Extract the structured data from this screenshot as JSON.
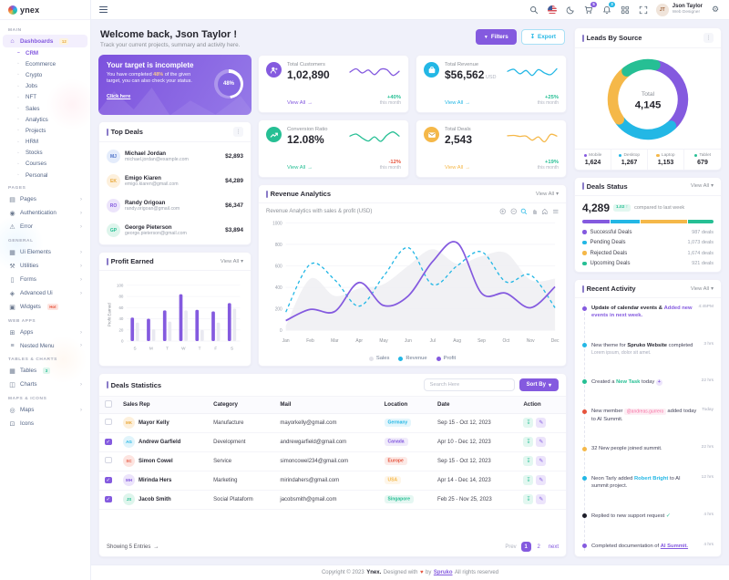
{
  "icons": {
    "chevron_down": "▾",
    "arrow_right": "→",
    "kebab": "⋮",
    "check": "✓",
    "heart": "♥",
    "pencil": "✎",
    "download": "↧",
    "plus": "+",
    "funnel": "▼"
  },
  "sidebar": {
    "logo": "ynex",
    "sections": [
      {
        "label": "MAIN",
        "items": [
          {
            "glyph": "⌂",
            "icon": "home-icon",
            "label": "Dashboards",
            "badge": "12",
            "badge_color": "warning",
            "active": true,
            "children": [
              {
                "label": "CRM",
                "active": true
              },
              {
                "label": "Ecommerce"
              },
              {
                "label": "Crypto"
              },
              {
                "label": "Jobs"
              },
              {
                "label": "NFT"
              },
              {
                "label": "Sales"
              },
              {
                "label": "Analytics"
              },
              {
                "label": "Projects"
              },
              {
                "label": "HRM"
              },
              {
                "label": "Stocks"
              },
              {
                "label": "Courses"
              },
              {
                "label": "Personal"
              }
            ]
          }
        ]
      },
      {
        "label": "PAGES",
        "items": [
          {
            "glyph": "▤",
            "icon": "pages-icon",
            "label": "Pages",
            "arrow": true
          },
          {
            "glyph": "◉",
            "icon": "authentication-icon",
            "label": "Authentication",
            "arrow": true
          },
          {
            "glyph": "⚠",
            "icon": "error-icon",
            "label": "Error",
            "arrow": true
          }
        ]
      },
      {
        "label": "GENERAL",
        "items": [
          {
            "glyph": "▦",
            "icon": "ui-elements-icon",
            "label": "Ui Elements",
            "arrow": true
          },
          {
            "glyph": "⚒",
            "icon": "utilities-icon",
            "label": "Utilities",
            "arrow": true
          },
          {
            "glyph": "▯",
            "icon": "forms-icon",
            "label": "Forms",
            "arrow": true
          },
          {
            "glyph": "◈",
            "icon": "advanced-ui-icon",
            "label": "Advanced Ui",
            "arrow": true
          },
          {
            "glyph": "▣",
            "icon": "widgets-icon",
            "label": "Widgets",
            "badge": "Hot",
            "badge_color": "danger"
          }
        ]
      },
      {
        "label": "WEB APPS",
        "items": [
          {
            "glyph": "⊞",
            "icon": "apps-icon",
            "label": "Apps",
            "arrow": true
          },
          {
            "glyph": "≡",
            "icon": "nested-menu-icon",
            "label": "Nested Menu",
            "arrow": true
          }
        ]
      },
      {
        "label": "TABLES & CHARTS",
        "items": [
          {
            "glyph": "▦",
            "icon": "tables-icon",
            "label": "Tables",
            "badge": "3",
            "badge_color": "success"
          },
          {
            "glyph": "◫",
            "icon": "charts-icon",
            "label": "Charts",
            "arrow": true
          }
        ]
      },
      {
        "label": "MAPS & ICONS",
        "items": [
          {
            "glyph": "◎",
            "icon": "maps-icon",
            "label": "Maps",
            "arrow": true
          },
          {
            "glyph": "⊡",
            "icon": "icons-icon",
            "label": "Icons"
          }
        ]
      }
    ]
  },
  "header": {
    "cart_badge": "5",
    "bell_badge": "3",
    "user": {
      "name": "Json Taylor",
      "role": "Web Designer",
      "initials": "JT"
    }
  },
  "welcome": {
    "title": "Welcome back, Json Taylor !",
    "subtitle": "Track your current projects, summary and activity here.",
    "filters_label": "Filters",
    "export_label": "Export"
  },
  "target_card": {
    "title": "Your target is incomplete",
    "text_before": "You have completed ",
    "highlight": "48%",
    "text_after": " of the given target, you can also check your status.",
    "link": "Click here",
    "progress": "48%"
  },
  "stats": [
    {
      "label": "Total Customers",
      "value": "1,02,890",
      "unit": "",
      "view_all": "View All",
      "change": "+40%",
      "dir": "up",
      "period": "this month",
      "color": "#845adf",
      "icon": "people",
      "spark": [
        55,
        75,
        50,
        68,
        40,
        72,
        70,
        35,
        60
      ]
    },
    {
      "label": "Total Revenue",
      "value": "$56,562",
      "unit": "USD",
      "view_all": "View All",
      "change": "+25%",
      "dir": "up",
      "period": "this month",
      "color": "#23b7e5",
      "icon": "bag",
      "spark": [
        60,
        72,
        45,
        65,
        35,
        70,
        50,
        40,
        75
      ]
    },
    {
      "label": "Conversion Ratio",
      "value": "12.08%",
      "unit": "",
      "view_all": "View All",
      "change": "-12%",
      "dir": "down",
      "period": "this month",
      "color": "#26bf94",
      "icon": "trend",
      "spark": [
        60,
        72,
        48,
        30,
        55,
        28,
        65,
        85,
        60
      ]
    },
    {
      "label": "Total Deals",
      "value": "2,543",
      "unit": "",
      "view_all": "View All",
      "change": "+19%",
      "dir": "up",
      "period": "this month",
      "color": "#f5b849",
      "icon": "mail",
      "spark": [
        62,
        64,
        58,
        60,
        35,
        55,
        25,
        70,
        60
      ]
    }
  ],
  "top_deals": {
    "title": "Top Deals",
    "entries": [
      {
        "name": "Michael Jordan",
        "email": "michael.jordan@example.com",
        "amount": "$2,893",
        "initials": "MJ",
        "av_bg": "#e4ecfb",
        "av_fg": "#4b70c9"
      },
      {
        "name": "Emigo Kiaren",
        "email": "emigo.kiaren@gmail.com",
        "amount": "$4,289",
        "initials": "EK",
        "av_bg": "#fdf0dc",
        "av_fg": "#e9a93c"
      },
      {
        "name": "Randy Origoan",
        "email": "randy.origoan@gmail.com",
        "amount": "$6,347",
        "initials": "RO",
        "av_bg": "#ece4fb",
        "av_fg": "#845adf"
      },
      {
        "name": "George Pieterson",
        "email": "george.pieterson@gmail.com",
        "amount": "$3,894",
        "initials": "GP",
        "av_bg": "#def5ec",
        "av_fg": "#26bf94"
      }
    ]
  },
  "profit_earned": {
    "title": "Profit Earned",
    "view_all": "View All",
    "chart": {
      "type": "bar",
      "categories": [
        "S",
        "M",
        "T",
        "W",
        "T",
        "F",
        "S"
      ],
      "series": [
        {
          "name": "Profit",
          "color": "#845adf",
          "values": [
            42,
            40,
            55,
            84,
            56,
            53,
            68
          ]
        },
        {
          "name": "Previous",
          "color": "#e9e9f1",
          "values": [
            33,
            21,
            35,
            55,
            20,
            33,
            58
          ]
        }
      ],
      "ylabel": "Profit Earned",
      "ylim": [
        0,
        100
      ],
      "ystep": 20
    }
  },
  "revenue_analytics": {
    "title": "Revenue Analytics",
    "view_all": "View All",
    "subtitle": "Revenue Analytics with sales & profit (USD)",
    "chart": {
      "type": "line",
      "x": [
        "Jan",
        "Feb",
        "Mar",
        "Apr",
        "May",
        "Jun",
        "Jul",
        "Aug",
        "Sep",
        "Oct",
        "Nov",
        "Dec"
      ],
      "series": [
        {
          "name": "Sales",
          "style": "area",
          "color": "#efeff3",
          "dot": "#e3e3ea",
          "values": [
            40,
            480,
            320,
            390,
            430,
            600,
            755,
            620,
            690,
            720,
            470,
            480
          ]
        },
        {
          "name": "Revenue",
          "style": "dashed",
          "color": "#23b7e5",
          "dot": "#23b7e5",
          "values": [
            170,
            615,
            470,
            225,
            505,
            770,
            425,
            600,
            730,
            450,
            515,
            210
          ]
        },
        {
          "name": "Profit",
          "style": "solid",
          "color": "#845adf",
          "dot": "#845adf",
          "values": [
            90,
            195,
            175,
            445,
            230,
            320,
            640,
            815,
            345,
            345,
            210,
            405
          ]
        }
      ],
      "ylim": [
        0,
        1000
      ],
      "ystep": 200
    }
  },
  "leads_by_source": {
    "title": "Leads By Source",
    "center_label": "Total",
    "center_value": "4,145",
    "segments": [
      {
        "label": "Mobile",
        "value": "1,624",
        "num": 1624,
        "color": "#845adf"
      },
      {
        "label": "Desktop",
        "value": "1,267",
        "num": 1267,
        "color": "#23b7e5"
      },
      {
        "label": "Laptop",
        "value": "1,153",
        "num": 1153,
        "color": "#f5b849"
      },
      {
        "label": "Tablet",
        "value": "679",
        "num": 679,
        "color": "#26bf94"
      }
    ]
  },
  "deals_status": {
    "title": "Deals Status",
    "view_all": "View All",
    "value": "4,289",
    "badge": "1.02 ↑",
    "compare": "compared to last week",
    "items": [
      {
        "label": "Successful Deals",
        "value": "987 deals",
        "num": 987,
        "color": "#845adf"
      },
      {
        "label": "Pending Deals",
        "value": "1,073 deals",
        "num": 1073,
        "color": "#23b7e5"
      },
      {
        "label": "Rejected Deals",
        "value": "1,674 deals",
        "num": 1674,
        "color": "#f5b849"
      },
      {
        "label": "Upcoming Deals",
        "value": "921 deals",
        "num": 921,
        "color": "#26bf94"
      }
    ]
  },
  "recent_activity": {
    "title": "Recent Activity",
    "view_all": "View All",
    "items": [
      {
        "dot": "#845adf",
        "time": "4:45PM",
        "parts": [
          {
            "s": "fw",
            "t": "Update of calendar events &"
          },
          {
            "s": "lp",
            "t": "Added new events in next week."
          }
        ]
      },
      {
        "dot": "#23b7e5",
        "time": "3 hrs",
        "parts": [
          {
            "s": "p",
            "t": "New theme for"
          },
          {
            "s": "fw",
            "t": "Spruko Website"
          },
          {
            "s": "p",
            "t": "completed"
          }
        ],
        "sub": "Lorem ipsum, dolor sit amet."
      },
      {
        "dot": "#26bf94",
        "time": "22 hrs",
        "parts": [
          {
            "s": "p",
            "t": "Created a"
          },
          {
            "s": "ls",
            "t": "New Task"
          },
          {
            "s": "p",
            "t": "today"
          }
        ],
        "suffix": "plus"
      },
      {
        "dot": "#e6533c",
        "time": "Today",
        "parts": [
          {
            "s": "p",
            "t": "New member"
          },
          {
            "s": "bp",
            "t": "@andreas.gurrero"
          },
          {
            "s": "p",
            "t": "added today to AI Summit."
          }
        ]
      },
      {
        "dot": "#f5b849",
        "time": "22 hrs",
        "parts": [
          {
            "s": "p",
            "t": "32 New people joined summit."
          }
        ]
      },
      {
        "dot": "#23b7e5",
        "time": "12 hrs",
        "parts": [
          {
            "s": "p",
            "t": "Neon Tarly added"
          },
          {
            "s": "li2",
            "t": "Robert Bright"
          },
          {
            "s": "p",
            "t": "to AI summit project."
          }
        ]
      },
      {
        "dot": "#1c1c28",
        "time": "4 hrs",
        "parts": [
          {
            "s": "p",
            "t": "Replied to new support request"
          }
        ],
        "suffix": "check"
      },
      {
        "dot": "#845adf",
        "time": "4 hrs",
        "parts": [
          {
            "s": "p",
            "t": "Completed documentation of"
          },
          {
            "s": "lu",
            "t": "AI Summit."
          }
        ]
      }
    ]
  },
  "deals_table": {
    "title": "Deals Statistics",
    "search_placeholder": "Search Here",
    "sort_label": "Sort By",
    "columns": [
      "Sales Rep",
      "Category",
      "Mail",
      "Location",
      "Date",
      "Action"
    ],
    "rows": [
      {
        "checked": false,
        "name": "Mayor Kelly",
        "initials": "MK",
        "av_bg": "#fdf0dc",
        "av_fg": "#e9a93c",
        "category": "Manufacture",
        "mail": "mayorkelly@gmail.com",
        "location": "Germany",
        "loc_color": "#23b7e5",
        "date": "Sep 15 - Oct 12, 2023"
      },
      {
        "checked": true,
        "name": "Andrew Garfield",
        "initials": "AG",
        "av_bg": "#e0f4fb",
        "av_fg": "#23b7e5",
        "category": "Development",
        "mail": "andrewgarfield@gmail.com",
        "location": "Canada",
        "loc_color": "#845adf",
        "date": "Apr 10 - Dec 12, 2023"
      },
      {
        "checked": false,
        "name": "Simon Cowel",
        "initials": "SC",
        "av_bg": "#fde4e0",
        "av_fg": "#e6533c",
        "category": "Service",
        "mail": "simoncowel234@gmail.com",
        "location": "Europe",
        "loc_color": "#e6533c",
        "date": "Sep 15 - Oct 12, 2023"
      },
      {
        "checked": true,
        "name": "Mirinda Hers",
        "initials": "MH",
        "av_bg": "#ece4fb",
        "av_fg": "#845adf",
        "category": "Marketing",
        "mail": "mirindahers@gmail.com",
        "location": "USA",
        "loc_color": "#f5b849",
        "date": "Apr 14 - Dec 14, 2023"
      },
      {
        "checked": true,
        "name": "Jacob Smith",
        "initials": "JS",
        "av_bg": "#def5ec",
        "av_fg": "#26bf94",
        "category": "Social Plataform",
        "mail": "jacobsmith@gmail.com",
        "location": "Singapore",
        "loc_color": "#26bf94",
        "date": "Feb 25 - Nov 25, 2023"
      }
    ],
    "footer": {
      "showing": "Showing 5 Entries",
      "prev": "Prev",
      "pages": [
        "1",
        "2"
      ],
      "active_page": "1",
      "next": "next"
    }
  },
  "page_footer": {
    "pre": "Copyright © 2023",
    "brand": "Ynex.",
    "mid": "Designed with",
    "heart": "♥",
    "by": "by",
    "vendor": "Spruko",
    "post": "All rights reserved"
  }
}
